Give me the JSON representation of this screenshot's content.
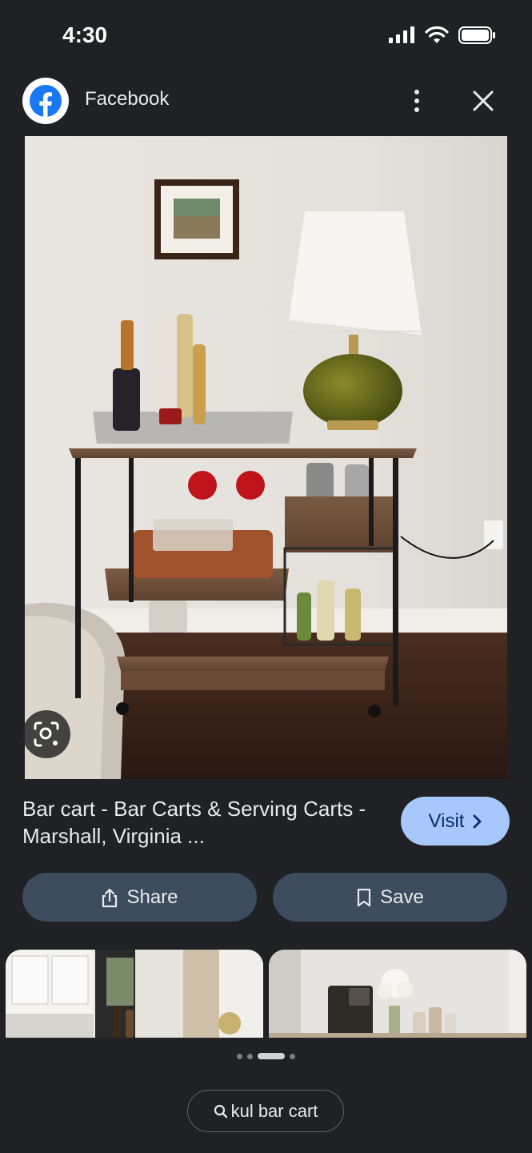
{
  "status_bar": {
    "time": "4:30"
  },
  "header": {
    "source_name": "Facebook"
  },
  "result": {
    "title": "Bar cart - Bar Carts & Serving Carts - Marshall, Virginia ..."
  },
  "buttons": {
    "visit": "Visit",
    "share": "Share",
    "save": "Save"
  },
  "pager": {
    "pages": 4,
    "active_index": 2
  },
  "search_chip": {
    "query": "kul bar cart"
  },
  "colors": {
    "background": "#202124",
    "visit_button": "#a8c7fa",
    "action_button": "#3c4b5e",
    "facebook_blue": "#1877f2"
  }
}
